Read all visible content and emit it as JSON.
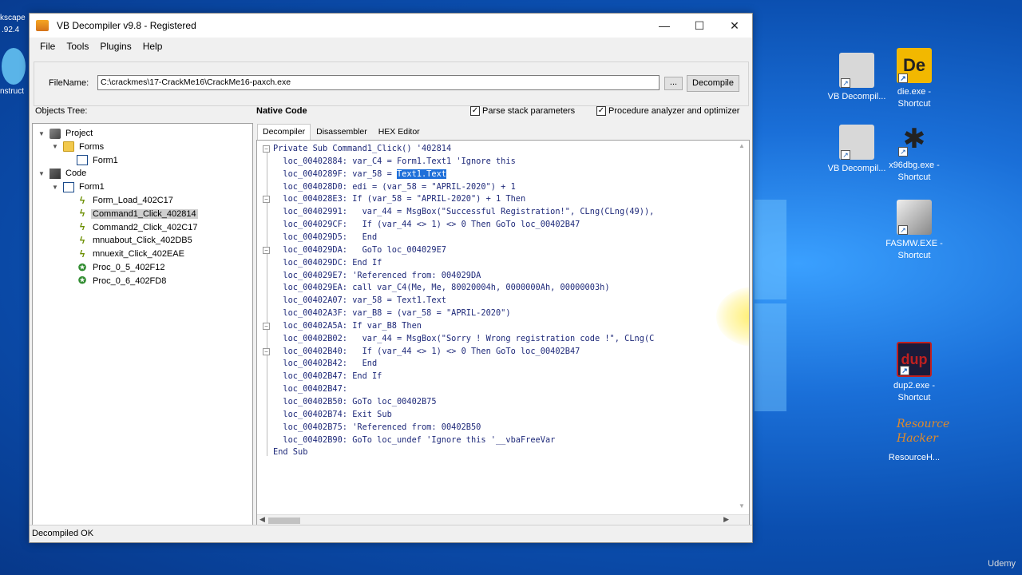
{
  "desktop": {
    "left_edge": [
      "kscape",
      ".92.4",
      "nstruct"
    ],
    "icons": [
      {
        "label": "VB Decompil... ",
        "label2": "",
        "color": "#c9c9c9"
      },
      {
        "label": "die.exe - Shortcut",
        "color": "#f2b800"
      },
      {
        "label": "VB Decompil...",
        "color": "#c9c9c9"
      },
      {
        "label": "x96dbg.exe - Shortcut",
        "color": "#2a2a2a"
      },
      {
        "label": "FASMW.EXE - Shortcut",
        "color": "#d0d0d0"
      },
      {
        "label": "dup2.exe - Shortcut",
        "color": "#c02020"
      },
      {
        "label": "ResourceH...",
        "logo": "Resource Hacker",
        "color": "#0b4fb0"
      }
    ],
    "watermark": "Udemy"
  },
  "window": {
    "title": "VB Decompiler v9.8 - Registered",
    "controls": {
      "minimize": "—",
      "maximize": "☐",
      "close": "✕"
    },
    "menu": [
      "File",
      "Tools",
      "Plugins",
      "Help"
    ],
    "filename_label": "FileName:",
    "filename_value": "C:\\crackmes\\17-CrackMe16\\CrackMe16-paxch.exe",
    "browse_label": "...",
    "decompile_label": "Decompile",
    "objects_tree_label": "Objects Tree:",
    "native_code_label": "Native Code",
    "options": [
      {
        "label": "Parse stack parameters",
        "checked": true
      },
      {
        "label": "Procedure analyzer and optimizer",
        "checked": true
      }
    ],
    "tabs": [
      "Decompiler",
      "Disassembler",
      "HEX Editor"
    ],
    "active_tab": "Decompiler",
    "status": "Decompiled OK"
  },
  "tree": [
    {
      "label": "Project",
      "icon": "project-icon",
      "level": 0,
      "expander": "▼"
    },
    {
      "label": "Forms",
      "icon": "folder-icon",
      "level": 1,
      "expander": "▼"
    },
    {
      "label": "Form1",
      "icon": "form-icon",
      "level": 2,
      "expander": ""
    },
    {
      "label": "Code",
      "icon": "code-icon",
      "level": 0,
      "expander": "▼"
    },
    {
      "label": "Form1",
      "icon": "form-icon",
      "level": 1,
      "expander": "▼"
    },
    {
      "label": "Form_Load_402C17",
      "icon": "event-icon",
      "level": 2,
      "expander": ""
    },
    {
      "label": "Command1_Click_402814",
      "icon": "event-icon",
      "level": 2,
      "expander": "",
      "selected": true
    },
    {
      "label": "Command2_Click_402C17",
      "icon": "event-icon",
      "level": 2,
      "expander": ""
    },
    {
      "label": "mnuabout_Click_402DB5",
      "icon": "event-icon",
      "level": 2,
      "expander": ""
    },
    {
      "label": "mnuexit_Click_402EAE",
      "icon": "event-icon",
      "level": 2,
      "expander": ""
    },
    {
      "label": "Proc_0_5_402F12",
      "icon": "proc-icon",
      "level": 2,
      "expander": ""
    },
    {
      "label": "Proc_0_6_402FD8",
      "icon": "proc-icon",
      "level": 2,
      "expander": ""
    }
  ],
  "code_lines": [
    "Private Sub Command1_Click() '402814",
    "  loc_00402884: var_C4 = Form1.Text1 'Ignore this",
    "  loc_0040289F: var_58 = Text1.Text",
    "  loc_004028D0: edi = (var_58 = \"APRIL-2020\") + 1",
    "  loc_004028E3: If (var_58 = \"APRIL-2020\") + 1 Then",
    "  loc_00402991:   var_44 = MsgBox(\"Successful Registration!\", CLng(CLng(49)),",
    "  loc_004029CF:   If (var_44 <> 1) <> 0 Then GoTo loc_00402B47",
    "  loc_004029D5:   End",
    "  loc_004029DA:   GoTo loc_004029E7",
    "  loc_004029DC: End If",
    "  loc_004029E7: 'Referenced from: 004029DA",
    "  loc_004029EA: call var_C4(Me, Me, 80020004h, 0000000Ah, 00000003h)",
    "  loc_00402A07: var_58 = Text1.Text",
    "  loc_00402A3F: var_B8 = (var_58 = \"APRIL-2020\")",
    "  loc_00402A5A: If var_B8 Then",
    "  loc_00402B02:   var_44 = MsgBox(\"Sorry ! Wrong registration code !\", CLng(C",
    "  loc_00402B40:   If (var_44 <> 1) <> 0 Then GoTo loc_00402B47",
    "  loc_00402B42:   End",
    "  loc_00402B47: End If",
    "  loc_00402B47:",
    "  loc_00402B50: GoTo loc_00402B75",
    "  loc_00402B74: Exit Sub",
    "  loc_00402B75: 'Referenced from: 00402B50",
    "  loc_00402B90: GoTo loc_undef 'Ignore this '__vbaFreeVar",
    "End Sub"
  ],
  "selected_text": "Text1.Text"
}
